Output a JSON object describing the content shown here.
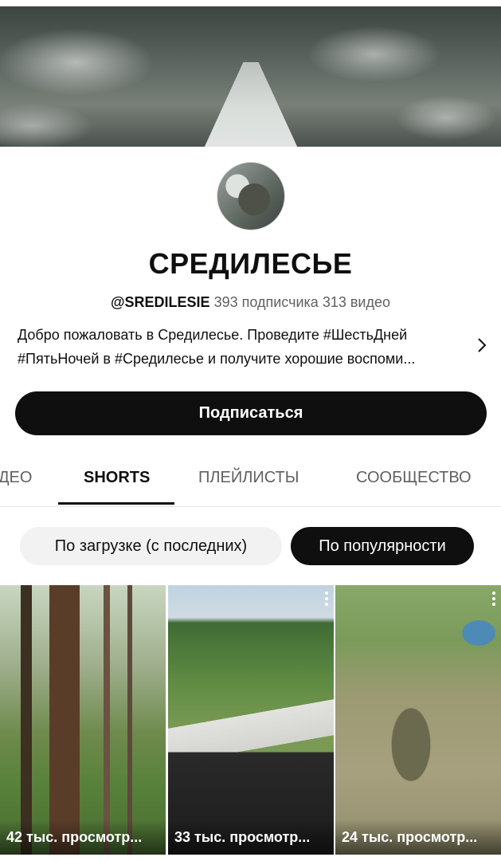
{
  "channel": {
    "name": "СРЕДИЛЕСЬЕ",
    "handle": "@SREDILESIE",
    "subscribers": "393 подписчика",
    "videos": "313 видео",
    "description_line1": "Добро пожаловать в Средилесье. Проведите #ШестьДней",
    "description_line2": "#ПятьНочей в #Средилесье и получите хорошие воспоми..."
  },
  "subscribe_label": "Подписаться",
  "tabs": [
    {
      "label": "ДЕО",
      "active": false
    },
    {
      "label": "SHORTS",
      "active": true
    },
    {
      "label": "ПЛЕЙЛИСТЫ",
      "active": false
    },
    {
      "label": "СООБЩЕСТВО",
      "active": false
    }
  ],
  "sort_chips": [
    {
      "label": "По загрузке (с последних)",
      "selected": false
    },
    {
      "label": "По популярности",
      "selected": true
    }
  ],
  "shorts": [
    {
      "views": "42 тыс. просмотр..."
    },
    {
      "views": "33 тыс. просмотр..."
    },
    {
      "views": "24 тыс. просмотр..."
    }
  ],
  "icons": {
    "description_expand": "chevron-right-icon",
    "short_menu": "more-vert-icon"
  }
}
